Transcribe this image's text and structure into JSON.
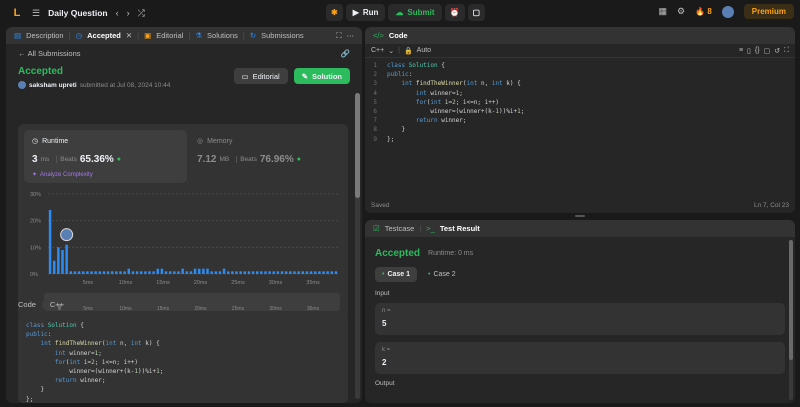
{
  "topbar": {
    "title": "Daily Question",
    "run": "Run",
    "submit": "Submit",
    "streak": "8",
    "premium": "Premium"
  },
  "left_tabs": [
    "Description",
    "Accepted",
    "Editorial",
    "Solutions",
    "Submissions"
  ],
  "submission": {
    "back": "All Submissions",
    "status": "Accepted",
    "user": "saksham upreti",
    "submitted": "submitted at Jul 08, 2024 10:44",
    "editorial_btn": "Editorial",
    "solution_btn": "Solution",
    "runtime_label": "Runtime",
    "runtime_value": "3",
    "runtime_unit": "ms",
    "beats_label": "Beats",
    "runtime_beats": "65.36%",
    "analyze": "Analyze Complexity",
    "memory_label": "Memory",
    "memory_value": "7.12",
    "memory_unit": "MB",
    "memory_beats": "76.96%"
  },
  "chart_data": {
    "type": "bar",
    "y_ticks": [
      "30%",
      "20%",
      "10%",
      "0%"
    ],
    "x_ticks": [
      "5ms",
      "10ms",
      "15ms",
      "20ms",
      "25ms",
      "30ms",
      "35ms"
    ],
    "ylim": [
      0,
      30
    ],
    "values": [
      24,
      5,
      10,
      9,
      11,
      1,
      1,
      1,
      1,
      1,
      1,
      1,
      1,
      1,
      1,
      1,
      1,
      1,
      1,
      2,
      1,
      1,
      1,
      1,
      1,
      1,
      2,
      2,
      1,
      1,
      1,
      1,
      2,
      1,
      1,
      2,
      2,
      2,
      2,
      1,
      1,
      1,
      2,
      1,
      1,
      1,
      1,
      1,
      1,
      1,
      1,
      1,
      1,
      1,
      1,
      1,
      1,
      1,
      1,
      1,
      1,
      1,
      1,
      1,
      1,
      1,
      1,
      1,
      1,
      1
    ],
    "highlight_index": 4,
    "highlight_color": "#2c8cf4"
  },
  "code_section": {
    "title": "Code",
    "lang": "C++"
  },
  "code_lines": [
    "class Solution {",
    "public:",
    "    int findTheWinner(int n, int k) {",
    "        int winner=1;",
    "        for(int i=2; i<=n; i++)",
    "            winner=(winner+(k-1))%i+1;",
    "        return winner;",
    "    }",
    "};"
  ],
  "editor": {
    "title": "Code",
    "lang": "C++",
    "auto": "Auto",
    "saved": "Saved",
    "position": "Ln 7, Col 23"
  },
  "test": {
    "tab1": "Testcase",
    "tab2": "Test Result",
    "status": "Accepted",
    "runtime": "Runtime: 0 ms",
    "case1": "Case 1",
    "case2": "Case 2",
    "input_label": "Input",
    "n_label": "n =",
    "n_value": "5",
    "k_label": "k =",
    "k_value": "2",
    "output_label": "Output"
  }
}
